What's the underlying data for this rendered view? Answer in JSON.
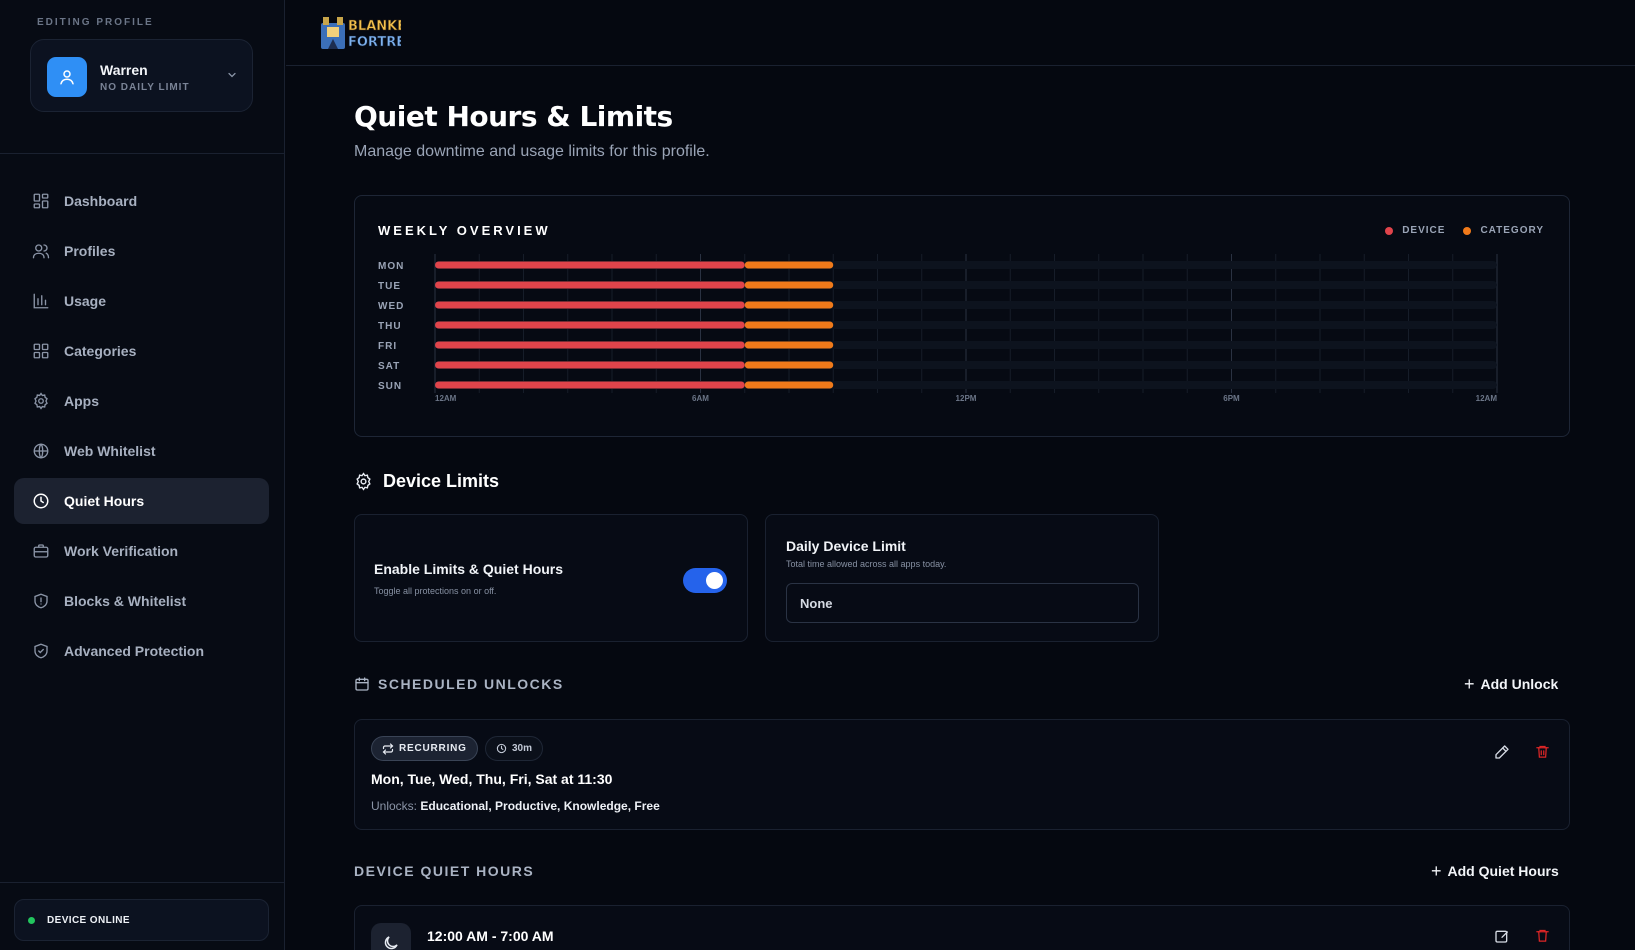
{
  "sidebar": {
    "caption": "EDITING PROFILE",
    "profile": {
      "name": "Warren",
      "subtitle": "NO DAILY LIMIT"
    },
    "items": [
      {
        "label": "Dashboard",
        "icon": "dashboard-icon"
      },
      {
        "label": "Profiles",
        "icon": "users-icon"
      },
      {
        "label": "Usage",
        "icon": "bar-chart-icon"
      },
      {
        "label": "Categories",
        "icon": "grid-icon"
      },
      {
        "label": "Apps",
        "icon": "gear-icon"
      },
      {
        "label": "Web Whitelist",
        "icon": "globe-icon"
      },
      {
        "label": "Quiet Hours",
        "icon": "clock-icon",
        "active": true
      },
      {
        "label": "Work Verification",
        "icon": "briefcase-icon"
      },
      {
        "label": "Blocks & Whitelist",
        "icon": "shield-alert-icon"
      },
      {
        "label": "Advanced Protection",
        "icon": "shield-check-icon"
      }
    ],
    "status": "DEVICE ONLINE"
  },
  "brand": {
    "logo_line1": "BLANKET",
    "logo_line2": "FORTRESS"
  },
  "page": {
    "title": "Quiet Hours & Limits",
    "subtitle": "Manage downtime and usage limits for this profile."
  },
  "overview": {
    "title": "WEEKLY OVERVIEW",
    "legend": {
      "device": "DEVICE",
      "category": "CATEGORY"
    },
    "colors": {
      "device": "#e0444b",
      "category": "#f07a1a"
    }
  },
  "chart_data": {
    "type": "bar",
    "orientation": "horizontal-timeline",
    "categories": [
      "MON",
      "TUE",
      "WED",
      "THU",
      "FRI",
      "SAT",
      "SUN"
    ],
    "x_ticks": [
      "12AM",
      "6AM",
      "12PM",
      "6PM",
      "12AM"
    ],
    "xlim": [
      0,
      24
    ],
    "series": [
      {
        "name": "DEVICE",
        "ranges": [
          [
            0,
            7
          ],
          [
            0,
            7
          ],
          [
            0,
            7
          ],
          [
            0,
            7
          ],
          [
            0,
            7
          ],
          [
            0,
            7
          ],
          [
            0,
            7
          ]
        ]
      },
      {
        "name": "CATEGORY",
        "ranges": [
          [
            7,
            9
          ],
          [
            7,
            9
          ],
          [
            7,
            9
          ],
          [
            7,
            9
          ],
          [
            7,
            9
          ],
          [
            7,
            9
          ],
          [
            7,
            9
          ]
        ]
      }
    ]
  },
  "device_limits": {
    "heading": "Device Limits",
    "enable": {
      "title": "Enable Limits & Quiet Hours",
      "desc": "Toggle all protections on or off.",
      "on": true
    },
    "daily": {
      "title": "Daily Device Limit",
      "desc": "Total time allowed across all apps today.",
      "value": "None"
    }
  },
  "scheduled_unlocks": {
    "heading": "SCHEDULED UNLOCKS",
    "add_label": "Add Unlock",
    "items": [
      {
        "badge": "RECURRING",
        "duration": "30m",
        "schedule": "Mon, Tue, Wed, Thu, Fri, Sat at 11:30",
        "unlocks_label": "Unlocks:",
        "unlocks": "Educational, Productive, Knowledge, Free"
      }
    ]
  },
  "quiet_hours": {
    "heading": "DEVICE QUIET HOURS",
    "add_label": "Add Quiet Hours",
    "items": [
      {
        "time": "12:00 AM - 7:00 AM"
      }
    ]
  }
}
